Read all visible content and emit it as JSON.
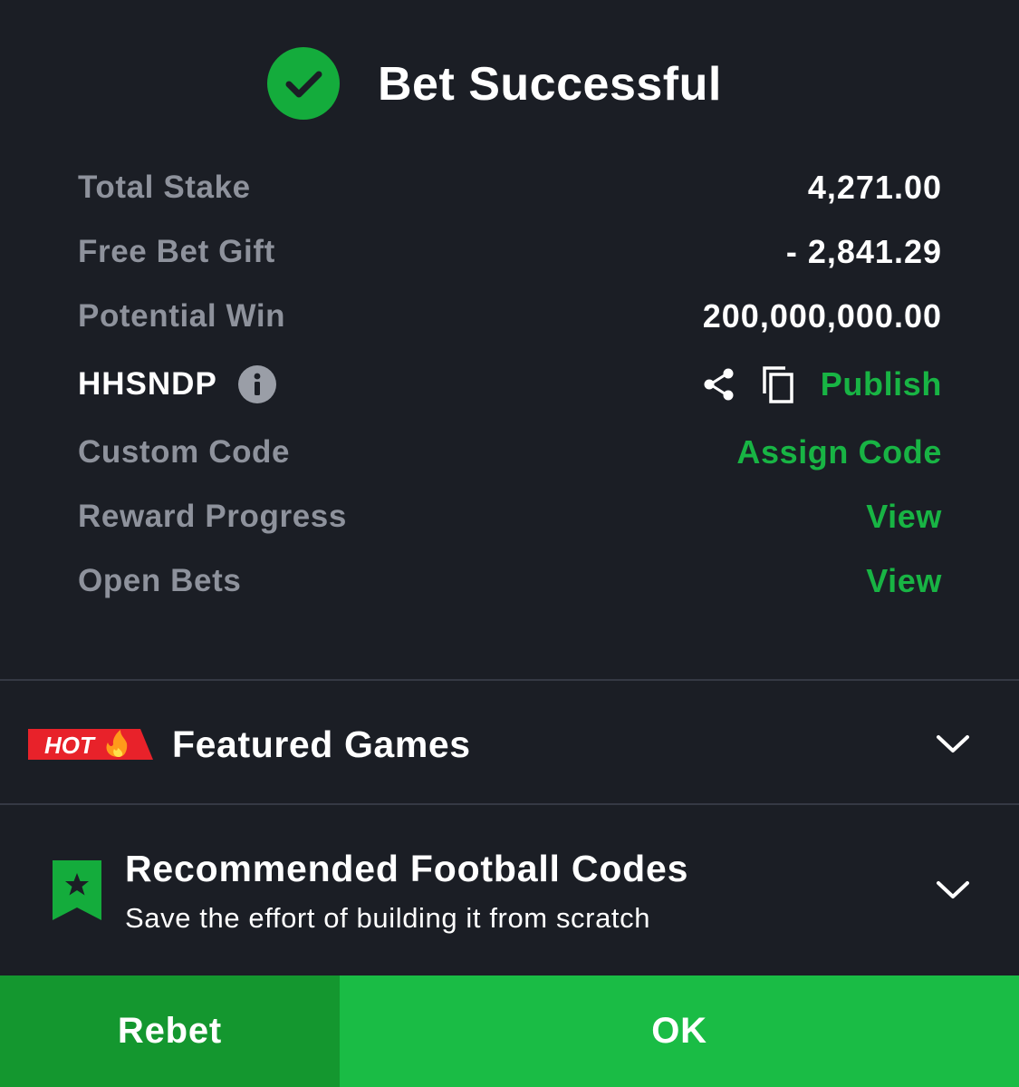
{
  "header": {
    "title": "Bet Successful",
    "icon": "check-circle-icon",
    "accent_color": "#14ac3c"
  },
  "summary": {
    "total_stake": {
      "label": "Total Stake",
      "value": "4,271.00"
    },
    "free_bet_gift": {
      "label": "Free Bet Gift",
      "value": "- 2,841.29"
    },
    "potential_win": {
      "label": "Potential Win",
      "value": "200,000,000.00"
    },
    "booking_code": {
      "code": "HHSNDP",
      "info_icon": "info-icon",
      "share_icon": "share-icon",
      "copy_icon": "copy-icon",
      "publish_label": "Publish"
    },
    "custom_code": {
      "label": "Custom Code",
      "action": "Assign Code"
    },
    "reward_progress": {
      "label": "Reward Progress",
      "action": "View"
    },
    "open_bets": {
      "label": "Open Bets",
      "action": "View"
    }
  },
  "featured_games": {
    "badge": "HOT",
    "badge_icon": "fire-icon",
    "title": "Featured Games",
    "chevron_icon": "chevron-down-icon"
  },
  "recommended_codes": {
    "icon": "bookmark-star-icon",
    "title": "Recommended Football Codes",
    "subtitle": "Save the effort of building it from scratch",
    "chevron_icon": "chevron-down-icon"
  },
  "buttons": {
    "rebet": "Rebet",
    "ok": "OK"
  },
  "colors": {
    "background": "#1b1e25",
    "link_green": "#18b444",
    "rebet_green": "#14972f",
    "ok_green": "#1abc45",
    "hot_red": "#e8222a"
  }
}
